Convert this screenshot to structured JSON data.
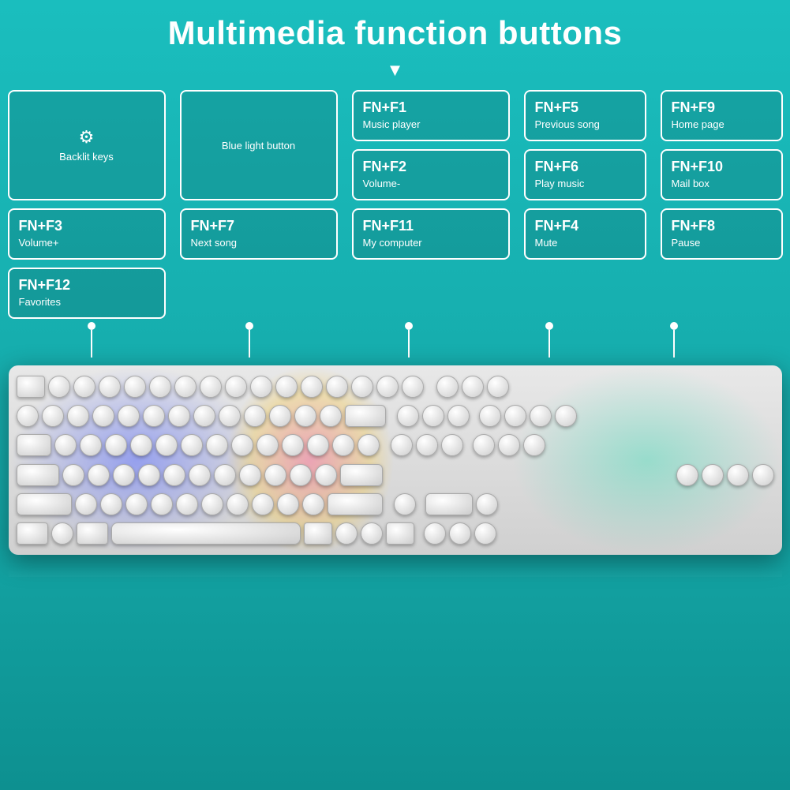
{
  "title": "Multimedia function buttons",
  "arrow": "▼",
  "buttons": [
    {
      "key": "FN+F1",
      "desc": "Music player"
    },
    {
      "key": "FN+F5",
      "desc": "Previous song"
    },
    {
      "key": "FN+F9",
      "desc": "Home page"
    },
    {
      "key": "special_backlit",
      "desc": "Backlit keys",
      "icon": "⚙"
    },
    {
      "key": "special_blue",
      "desc": "Blue light button",
      "icon": null
    },
    {
      "key": "FN+F2",
      "desc": "Volume-"
    },
    {
      "key": "FN+F6",
      "desc": "Play music"
    },
    {
      "key": "FN+F10",
      "desc": "Mail box"
    },
    {
      "key": "",
      "desc": "",
      "empty": true
    },
    {
      "key": "",
      "desc": "",
      "empty": true
    },
    {
      "key": "FN+F3",
      "desc": "Volume+"
    },
    {
      "key": "FN+F7",
      "desc": "Next song"
    },
    {
      "key": "FN+F11",
      "desc": "My computer"
    },
    {
      "key": "",
      "desc": "",
      "empty": true
    },
    {
      "key": "",
      "desc": "",
      "empty": true
    },
    {
      "key": "FN+F4",
      "desc": "Mute"
    },
    {
      "key": "FN+F8",
      "desc": "Pause"
    },
    {
      "key": "FN+F12",
      "desc": "Favorites"
    },
    {
      "key": "",
      "desc": "",
      "empty": true
    },
    {
      "key": "",
      "desc": "",
      "empty": true
    }
  ],
  "connector_positions": [
    130,
    360,
    570,
    750,
    900
  ],
  "colors": {
    "background": "#1abebe",
    "card_border": "#ffffff",
    "text": "#ffffff",
    "accent": "#1abebe"
  }
}
